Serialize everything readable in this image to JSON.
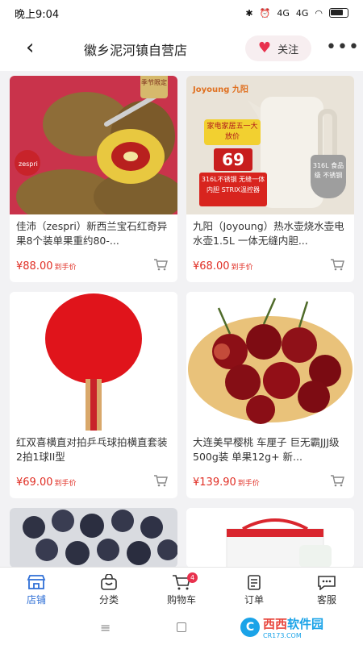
{
  "status": {
    "time": "晚上9:04",
    "signal1": "4G",
    "signal2": "4G"
  },
  "header": {
    "title": "徽乡泥河镇自营店",
    "follow_label": "关注"
  },
  "products": [
    {
      "name": "佳沛（zespri）新西兰宝石红奇异果8个装单果重约80-...",
      "price": "¥88.00",
      "price_suffix": "到手价",
      "badge": "季节限定"
    },
    {
      "name": "九阳（Joyoung）热水壶烧水壶电水壶1.5L 一体无缝内胆...",
      "price": "¥68.00",
      "price_suffix": "到手价",
      "brand": "Joyoung 九阳",
      "ad_top": "家电家居五一大放价",
      "ad_num": "69",
      "ad_red": "316L不锈钢 无缝一体内胆 STRIX温控器",
      "shield": "316L 食品级 不锈钢"
    },
    {
      "name": "红双喜横直对拍乒乓球拍横直套装2拍1球II型",
      "price": "¥69.00",
      "price_suffix": "到手价"
    },
    {
      "name": "大连美早樱桃 车厘子 巨无霸JJJ级 500g装 单果12g+ 新...",
      "price": "¥139.90",
      "price_suffix": "到手价"
    }
  ],
  "tabs": [
    {
      "label": "店铺",
      "icon": "store-icon"
    },
    {
      "label": "分类",
      "icon": "bag-icon"
    },
    {
      "label": "购物车",
      "icon": "cart-icon",
      "badge": "4"
    },
    {
      "label": "订单",
      "icon": "order-icon"
    },
    {
      "label": "客服",
      "icon": "chat-icon"
    }
  ],
  "watermark": {
    "brand1": "西西",
    "brand2": "软件园",
    "site": "CR173.COM"
  },
  "colors": {
    "accent": "#2f6fd6",
    "price": "#e02e24",
    "heart": "#e8314d"
  }
}
